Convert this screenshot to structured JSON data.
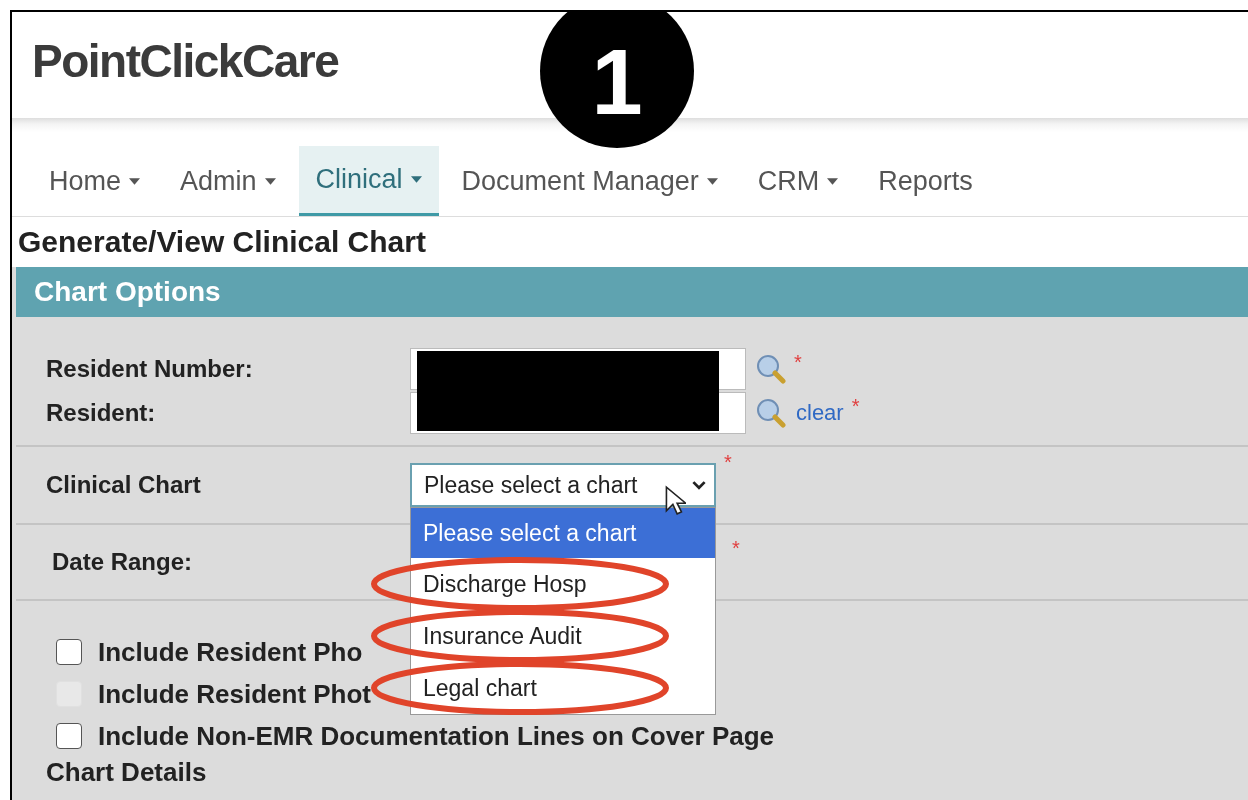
{
  "logo": "PointClickCare",
  "step_badge": "1",
  "nav": [
    {
      "label": "Home",
      "caret": true,
      "selected": false
    },
    {
      "label": "Admin",
      "caret": true,
      "selected": false
    },
    {
      "label": "Clinical",
      "caret": true,
      "selected": true
    },
    {
      "label": "Document Manager",
      "caret": true,
      "selected": false
    },
    {
      "label": "CRM",
      "caret": true,
      "selected": false
    },
    {
      "label": "Reports",
      "caret": false,
      "selected": false
    }
  ],
  "page_title": "Generate/View Clinical Chart",
  "panel_title": "Chart Options",
  "resident_fields": [
    {
      "label": "Resident Number:",
      "redacted": true
    },
    {
      "label": "Resident:",
      "redacted": true,
      "link": "clear"
    }
  ],
  "required_mark": "*",
  "clinical_chart": {
    "label": "Clinical Chart",
    "value": "Please select a chart",
    "expanded": true,
    "options": [
      {
        "label": "Please select a chart",
        "selected": true,
        "circled": false
      },
      {
        "label": "Discharge Hosp",
        "selected": false,
        "circled": true
      },
      {
        "label": "Insurance Audit",
        "selected": false,
        "circled": true
      },
      {
        "label": "Legal chart",
        "selected": false,
        "circled": true
      }
    ]
  },
  "date_range": {
    "label": "Date Range:"
  },
  "checkboxes": [
    {
      "label": "Include Resident Pho",
      "checked": false,
      "disabled": false
    },
    {
      "label": "Include Resident Phot",
      "checked": false,
      "disabled": true
    },
    {
      "label": "Include Non-EMR Documentation Lines on Cover Page",
      "checked": false,
      "disabled": false
    }
  ],
  "section_label": "Chart Details"
}
